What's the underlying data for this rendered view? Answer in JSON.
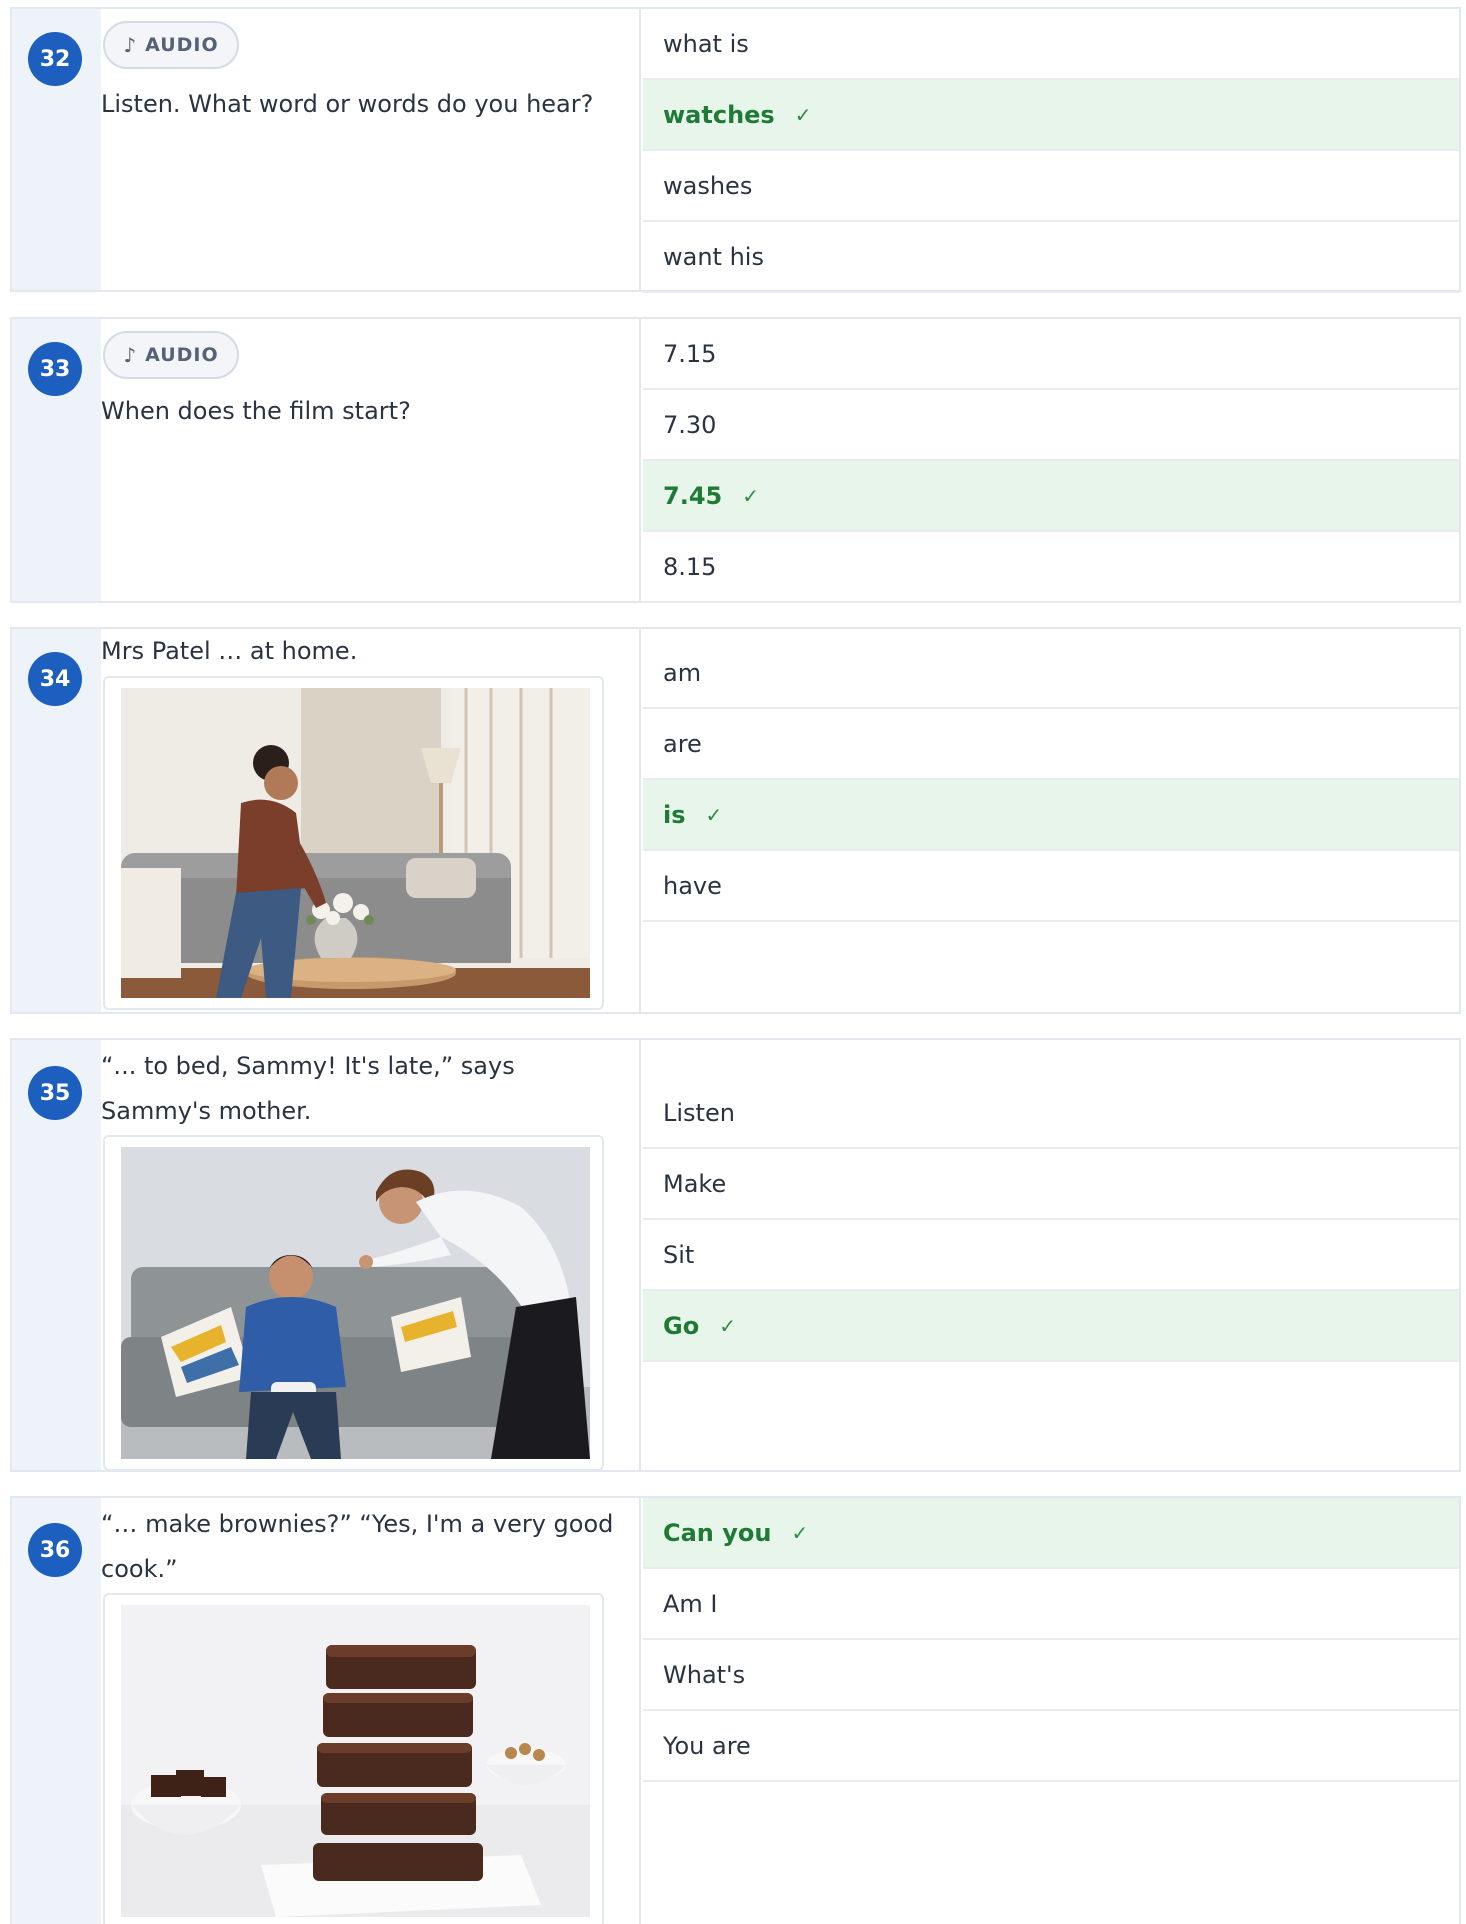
{
  "audio_label": "AUDIO",
  "audio_icon": "music-note-icon",
  "check_mark": "✓",
  "colors": {
    "accent": "#1d5fbf",
    "correct_bg": "#e8f5ea",
    "correct_text": "#1e7a34"
  },
  "questions": [
    {
      "number": "32",
      "has_audio": true,
      "text": "Listen. What word or words do you hear?",
      "options": [
        {
          "label": "what is",
          "correct": false
        },
        {
          "label": "watches",
          "correct": true
        },
        {
          "label": "washes",
          "correct": false
        },
        {
          "label": "want his",
          "correct": false
        }
      ]
    },
    {
      "number": "33",
      "has_audio": true,
      "text": "When does the film start?",
      "options": [
        {
          "label": "7.15",
          "correct": false
        },
        {
          "label": "7.30",
          "correct": false
        },
        {
          "label": "7.45",
          "correct": true
        },
        {
          "label": "8.15",
          "correct": false
        }
      ]
    },
    {
      "number": "34",
      "has_audio": false,
      "text": "Mrs Patel … at home.",
      "image": "living-room-photo",
      "options": [
        {
          "label": "am",
          "correct": false
        },
        {
          "label": "are",
          "correct": false
        },
        {
          "label": "is",
          "correct": true
        },
        {
          "label": "have",
          "correct": false
        }
      ]
    },
    {
      "number": "35",
      "has_audio": false,
      "text_lines": [
        "“... to bed, Sammy! It's late,” says",
        "Sammy's mother."
      ],
      "image": "mother-and-boy-photo",
      "options": [
        {
          "label": "Listen",
          "correct": false
        },
        {
          "label": "Make",
          "correct": false
        },
        {
          "label": "Sit",
          "correct": false
        },
        {
          "label": "Go",
          "correct": true
        }
      ]
    },
    {
      "number": "36",
      "has_audio": false,
      "text_lines": [
        "“… make brownies?” “Yes, I'm a very good",
        "cook.”"
      ],
      "image": "brownies-photo",
      "options": [
        {
          "label": "Can you",
          "correct": true
        },
        {
          "label": "Am I",
          "correct": false
        },
        {
          "label": "What's",
          "correct": false
        },
        {
          "label": "You are",
          "correct": false
        }
      ]
    }
  ]
}
